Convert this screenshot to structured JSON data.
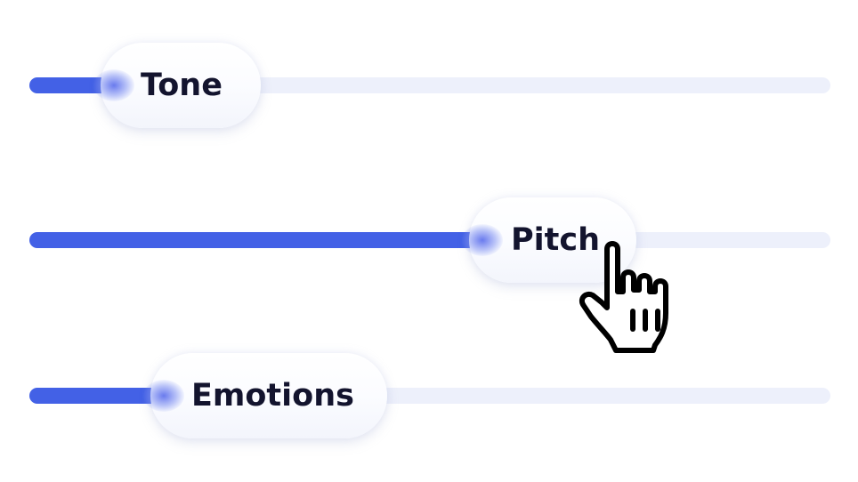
{
  "sliders": [
    {
      "label": "Tone",
      "value": 0.1
    },
    {
      "label": "Pitch",
      "value": 0.56
    },
    {
      "label": "Emotions",
      "value": 0.16
    }
  ],
  "colors": {
    "accent": "#4361e6",
    "track": "#edf0fb",
    "label": "#13142e",
    "background": "#ffffff"
  },
  "icons": {
    "cursor": "hand-pointer-icon"
  }
}
